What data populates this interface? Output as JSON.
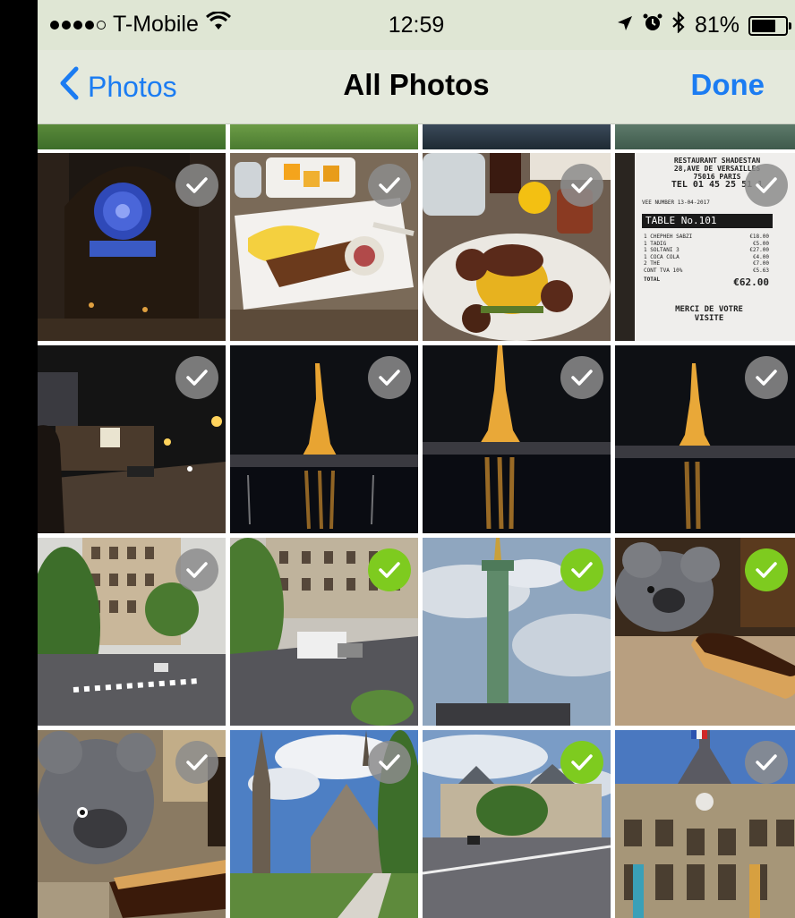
{
  "status_bar": {
    "signal_dots_filled": 4,
    "signal_dots_total": 5,
    "carrier": "T-Mobile",
    "wifi_icon": "wifi-icon",
    "time": "12:59",
    "location_icon": "location-arrow-icon",
    "alarm_icon": "alarm-clock-icon",
    "bluetooth_icon": "bluetooth-icon",
    "battery_percent": "81%",
    "battery_level": 0.81
  },
  "nav": {
    "back_label": "Photos",
    "title": "All Photos",
    "done_label": "Done",
    "accent_color": "#1b7cf2"
  },
  "grid": {
    "selected_color": "#7ecb1f",
    "unselected_color": "#8c8c8c",
    "top_strip": [
      {
        "subject": "trees"
      },
      {
        "subject": "trees"
      },
      {
        "subject": "street"
      },
      {
        "subject": "water"
      }
    ],
    "photos": [
      {
        "subject": "cathedral-rose-window",
        "selected": false
      },
      {
        "subject": "kebab-plate",
        "selected": false
      },
      {
        "subject": "meat-dish",
        "selected": false
      },
      {
        "subject": "restaurant-receipt",
        "selected": false
      },
      {
        "subject": "night-street",
        "selected": false
      },
      {
        "subject": "eiffel-tower-night",
        "selected": false
      },
      {
        "subject": "eiffel-tower-night",
        "selected": false
      },
      {
        "subject": "eiffel-tower-night",
        "selected": false
      },
      {
        "subject": "paris-street-buildings",
        "selected": false
      },
      {
        "subject": "paris-street-truck",
        "selected": true
      },
      {
        "subject": "july-column",
        "selected": true
      },
      {
        "subject": "plush-koala-eclair",
        "selected": true
      },
      {
        "subject": "plush-koala-eclair-close",
        "selected": false
      },
      {
        "subject": "notre-dame-park",
        "selected": false
      },
      {
        "subject": "hotel-de-ville-street",
        "selected": true
      },
      {
        "subject": "hotel-de-ville-facade",
        "selected": false
      }
    ]
  },
  "receipt": {
    "line1": "RESTAURANT SHADESTAN",
    "line2": "28,AVE DE VERSAILLES",
    "line3": "75016 PARIS",
    "line4": "TEL 01 45 25 51 1",
    "serveur": "VEE NUMBER 13-04-2017",
    "table": "TABLE No.101",
    "items": [
      {
        "name": "1 CHEPHEH SABZI",
        "price": "€18.00"
      },
      {
        "name": "1 TADIG",
        "price": "€5.00"
      },
      {
        "name": "1 SOLTANI 3",
        "price": "€27.00"
      },
      {
        "name": "1 COCA COLA",
        "price": "€4.00"
      },
      {
        "name": "2 THE",
        "price": "€7.00"
      },
      {
        "name": "CONT TVA 10%",
        "price": "€5.63"
      }
    ],
    "total_label": "TOTAL",
    "total_value": "€62.00",
    "thanks1": "MERCI DE VOTRE",
    "thanks2": "VISITE"
  }
}
